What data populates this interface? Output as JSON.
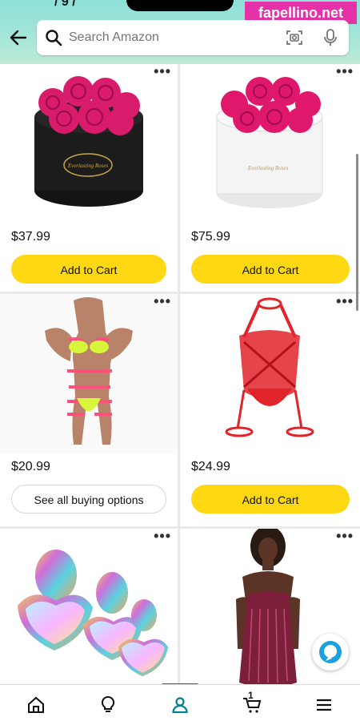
{
  "status": {
    "time_fragment": "/ 9 /"
  },
  "watermark": {
    "text": "fapellino.net"
  },
  "search": {
    "placeholder": "Search Amazon"
  },
  "products": [
    {
      "price": "$37.99",
      "button_label": "Add to Cart",
      "button_style": "primary",
      "image": "black-rose-box"
    },
    {
      "price": "$75.99",
      "button_label": "Add to Cart",
      "button_style": "primary",
      "image": "white-rose-box"
    },
    {
      "price": "$20.99",
      "button_label": "See all buying options",
      "button_style": "secondary",
      "image": "neon-lingerie-set"
    },
    {
      "price": "$24.99",
      "button_label": "Add to Cart",
      "button_style": "primary",
      "image": "red-harness-lingerie"
    },
    {
      "price": "",
      "button_label": "",
      "image": "jeweled-plug-set"
    },
    {
      "price": "",
      "button_label": "",
      "image": "sequin-fringe-dress"
    }
  ],
  "box_labels": {
    "black": "Everlasting Roses",
    "white": "Everlasting Roses"
  },
  "nav": {
    "items": [
      "home-icon",
      "inspire-icon",
      "account-icon",
      "cart-icon",
      "menu-icon"
    ],
    "cart_count": "1",
    "active": "account-icon"
  },
  "colors": {
    "accent": "#008296",
    "button_yellow": "#ffd814",
    "header_teal": "#8ee0d9"
  }
}
